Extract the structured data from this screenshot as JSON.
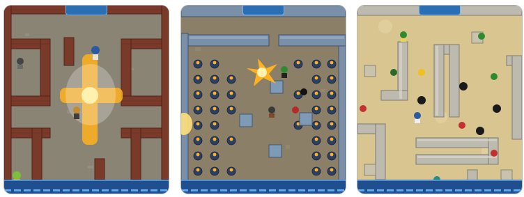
{
  "screenshots": [
    {
      "theme": "arena-brick",
      "hud": {
        "top_text": "",
        "bottom_left": "",
        "bottom_mid": "",
        "bottom_right": ""
      }
    },
    {
      "theme": "arena-steel",
      "hud": {
        "top_text": "",
        "bottom_left": "",
        "bottom_mid": "",
        "bottom_right": ""
      }
    },
    {
      "theme": "arena-sand",
      "hud": {
        "top_text": "",
        "bottom_left": "",
        "bottom_mid": "",
        "bottom_right": ""
      }
    }
  ],
  "colors": {
    "brick": "#7a3a2a",
    "floor_stone": "#8d8778",
    "steel_floor": "#8c7f68",
    "sand": "#d8c58f",
    "hud_blue": "#2a6fb3",
    "explosion": "#ffb21f"
  },
  "icons": [
    "bomber-player-icon",
    "bomb-icon",
    "explosion-icon",
    "destructible-block-icon",
    "wall-icon"
  ]
}
